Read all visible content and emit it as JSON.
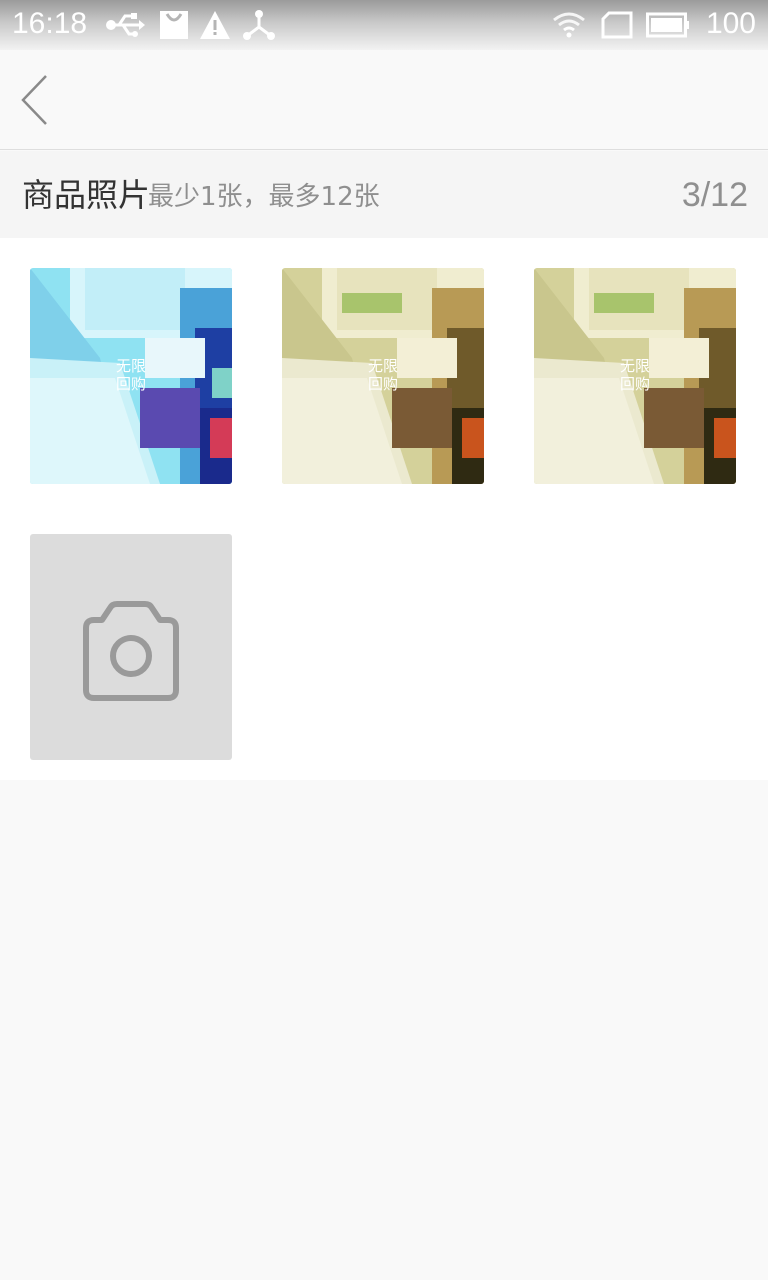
{
  "status_bar": {
    "time": "16:18",
    "battery": "100",
    "left_icons": [
      "usb-icon",
      "shopping-bag-icon",
      "warning-icon",
      "share-network-icon"
    ],
    "right_icons": [
      "wifi-icon",
      "sim-card-icon",
      "battery-icon"
    ]
  },
  "toolbar": {
    "back_icon": "chevron-left-icon"
  },
  "photos_section": {
    "title": "商品照片",
    "hint": "最少1张，最多12张",
    "count": "3/12"
  },
  "photos": [
    {
      "watermark_line1": "无限",
      "watermark_line2": "回购",
      "tint": "blue"
    },
    {
      "watermark_line1": "无限",
      "watermark_line2": "回购",
      "tint": "yellow"
    },
    {
      "watermark_line1": "无限",
      "watermark_line2": "回购",
      "tint": "yellow"
    }
  ],
  "add_photo": {
    "icon": "camera-icon"
  },
  "colors": {
    "background": "#f9f9f9",
    "panel": "#ffffff",
    "placeholder": "#dcdcdc",
    "muted_text": "#8f8f8f",
    "title_text": "#333333"
  }
}
